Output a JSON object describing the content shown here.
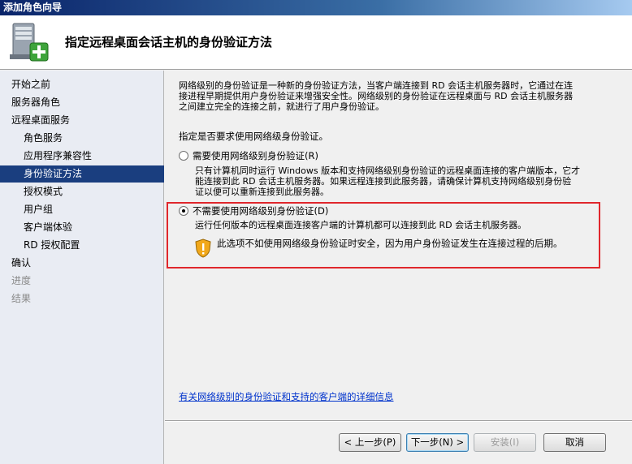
{
  "window": {
    "title": "添加角色向导"
  },
  "header": {
    "title": "指定远程桌面会话主机的身份验证方法",
    "icon": "server-add-icon"
  },
  "nav": {
    "items": [
      {
        "label": "开始之前",
        "level": 0,
        "state": "normal"
      },
      {
        "label": "服务器角色",
        "level": 0,
        "state": "normal"
      },
      {
        "label": "远程桌面服务",
        "level": 0,
        "state": "normal"
      },
      {
        "label": "角色服务",
        "level": 1,
        "state": "normal"
      },
      {
        "label": "应用程序兼容性",
        "level": 1,
        "state": "normal"
      },
      {
        "label": "身份验证方法",
        "level": 1,
        "state": "active"
      },
      {
        "label": "授权模式",
        "level": 1,
        "state": "normal"
      },
      {
        "label": "用户组",
        "level": 1,
        "state": "normal"
      },
      {
        "label": "客户端体验",
        "level": 1,
        "state": "normal"
      },
      {
        "label": "RD 授权配置",
        "level": 1,
        "state": "normal"
      },
      {
        "label": "确认",
        "level": 0,
        "state": "normal"
      },
      {
        "label": "进度",
        "level": 0,
        "state": "disabled"
      },
      {
        "label": "结果",
        "level": 0,
        "state": "disabled"
      }
    ]
  },
  "content": {
    "description_line1": "网络级别的身份验证是一种新的身份验证方法，当客户端连接到 RD 会话主机服务器时，它通过在连",
    "description_line2": "接进程早期提供用户身份验证来增强安全性。网络级别的身份验证在远程桌面与 RD 会话主机服务器",
    "description_line3": "之间建立完全的连接之前，就进行了用户身份验证。",
    "question": "指定是否要求使用网络级身份验证。",
    "options": [
      {
        "label": "需要使用网络级别身份验证(R)",
        "desc_line1": "只有计算机同时运行 Windows 版本和支持网络级别身份验证的远程桌面连接的客户端版本，它才",
        "desc_line2": "能连接到此 RD 会话主机服务器。如果远程连接到此服务器，请确保计算机支持网络级别身份验",
        "desc_line3": "证以便可以重新连接到此服务器。",
        "checked": false
      },
      {
        "label": "不需要使用网络级别身份验证(D)",
        "desc_line1": "运行任何版本的远程桌面连接客户端的计算机都可以连接到此 RD 会话主机服务器。",
        "checked": true
      }
    ],
    "warning": "此选项不如使用网络级身份验证时安全，因为用户身份验证发生在连接过程的后期。",
    "link": "有关网络级别的身份验证和支持的客户端的详细信息"
  },
  "footer": {
    "prev_label": "< 上一步(P)",
    "next_label": "下一步(N) >",
    "install_label": "安装(I)",
    "cancel_label": "取消"
  },
  "colors": {
    "nav_active": "#1a3e7f",
    "highlight_border": "#e0272c",
    "link": "#0033cc"
  }
}
